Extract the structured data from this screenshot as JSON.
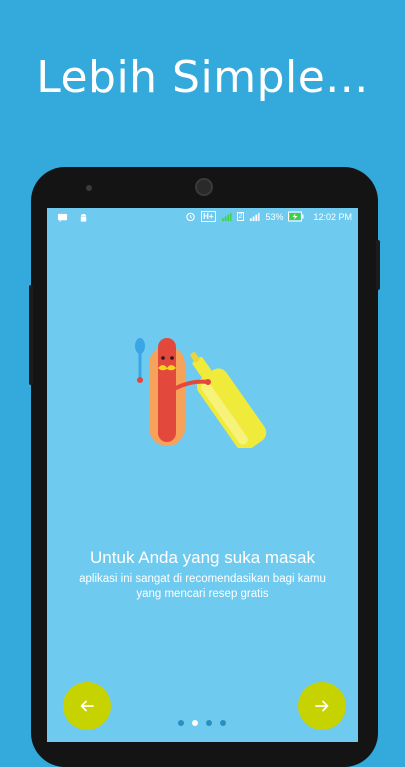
{
  "headline": "Lebih Simple...",
  "status_bar": {
    "battery_percent": "53%",
    "time": "12:02 PM",
    "network": "H+",
    "sim": "2"
  },
  "slide": {
    "title": "Untuk Anda yang suka masak",
    "description": "aplikasi ini sangat di recomendasikan bagi kamu yang mencari resep gratis"
  },
  "navigation": {
    "prev_icon": "arrow-left-icon",
    "next_icon": "arrow-right-icon",
    "page_count": 4,
    "active_page": 2,
    "accent_color": "#c6d300"
  },
  "colors": {
    "background": "#33a9dc",
    "screen": "#6fcaf0"
  }
}
